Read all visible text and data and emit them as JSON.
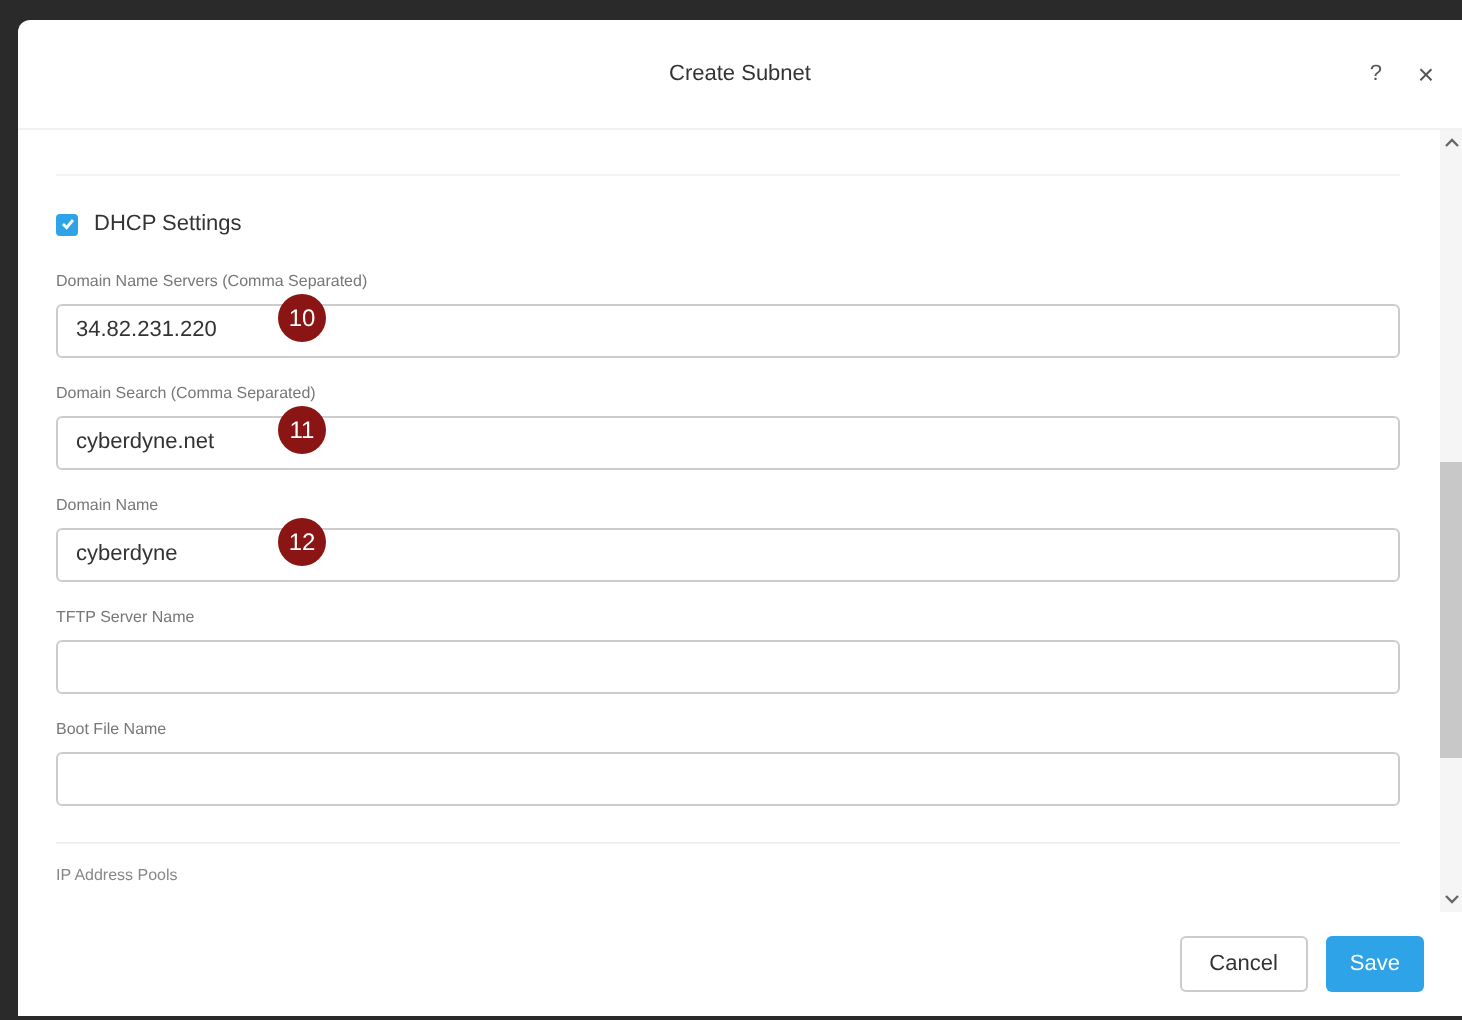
{
  "dialog": {
    "title": "Create Subnet",
    "help": "?",
    "close": "×"
  },
  "dhcp": {
    "label": "DHCP Settings",
    "checked": true
  },
  "fields": [
    {
      "label": "Domain Name Servers (Comma Separated)",
      "value": "34.82.231.220",
      "badge": "10"
    },
    {
      "label": "Domain Search (Comma Separated)",
      "value": "cyberdyne.net",
      "badge": "11"
    },
    {
      "label": "Domain Name",
      "value": "cyberdyne",
      "badge": "12"
    },
    {
      "label": "TFTP Server Name"
    },
    {
      "label": "Boot File Name"
    }
  ],
  "next_section": {
    "label": "IP Address Pools"
  },
  "buttons": {
    "cancel": "Cancel",
    "save": "Save"
  }
}
